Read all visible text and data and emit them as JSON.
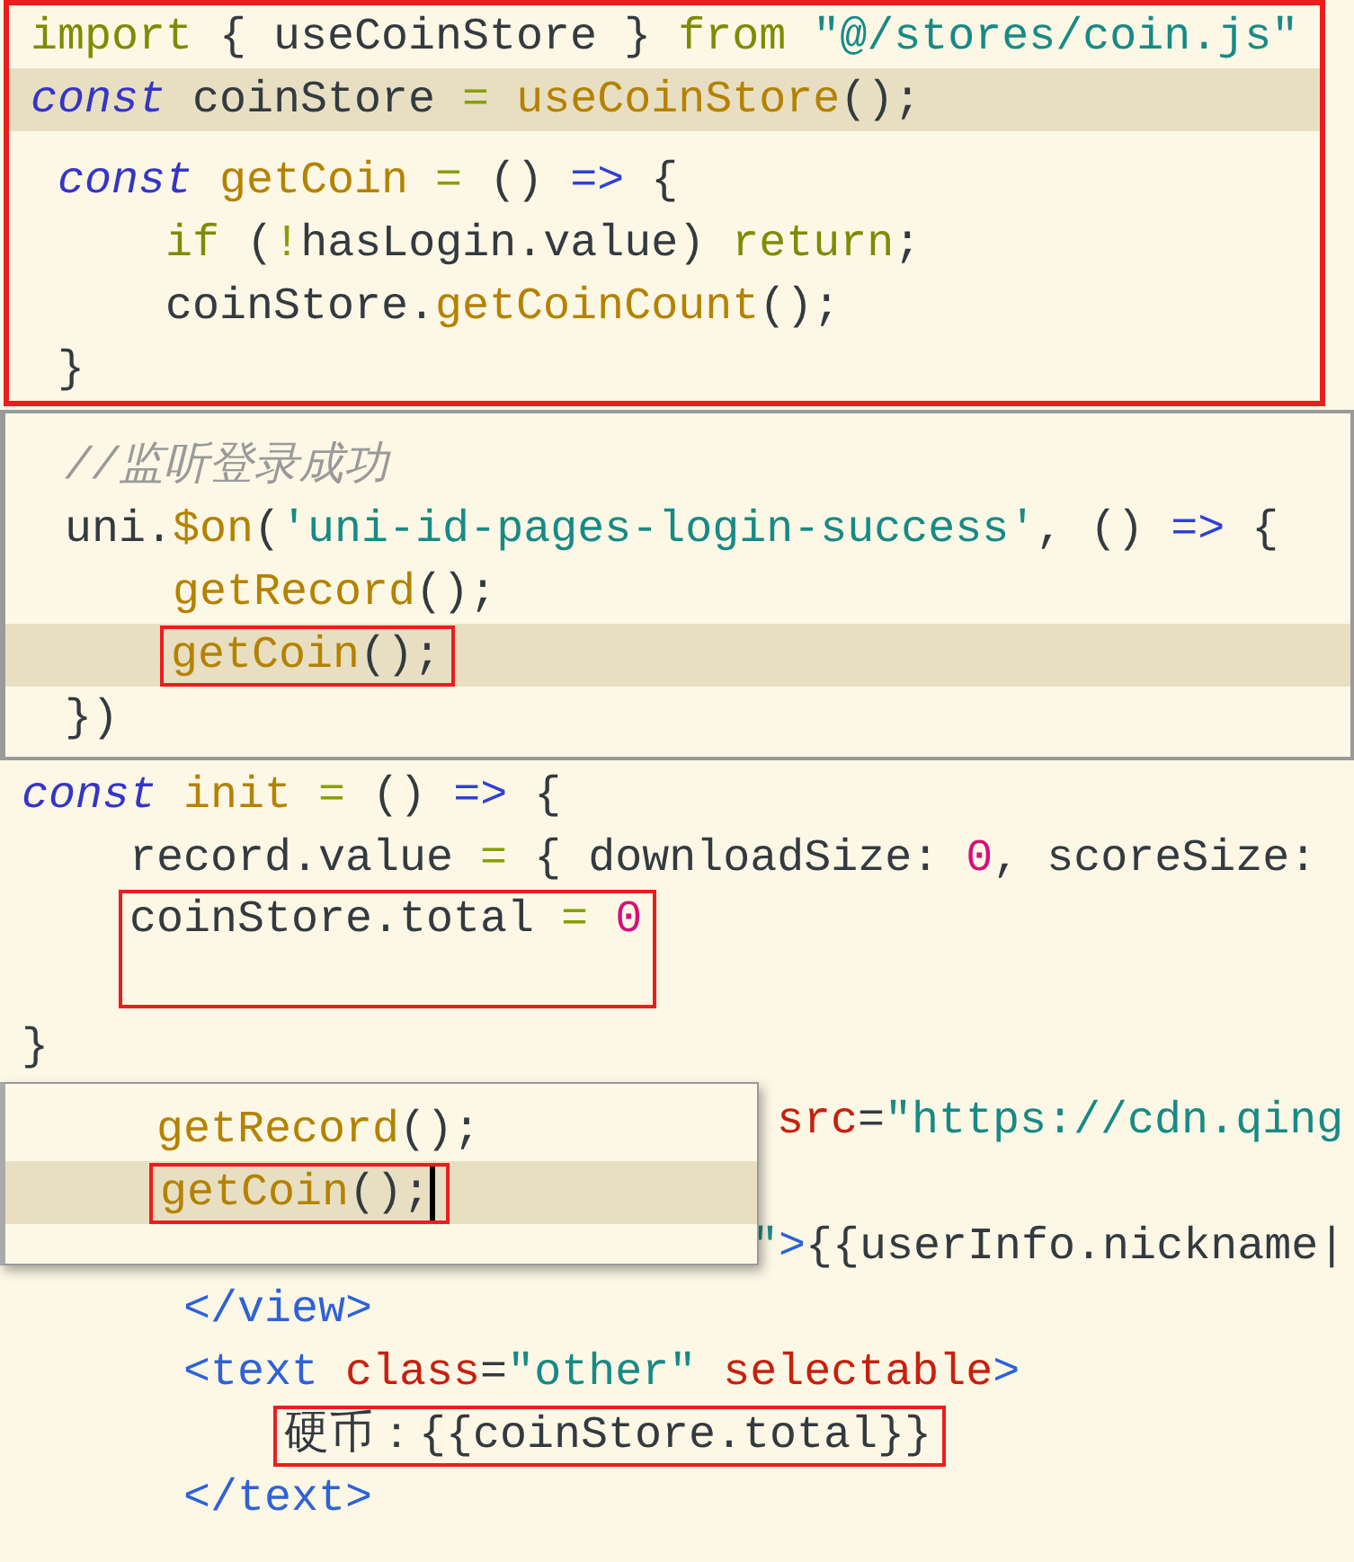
{
  "panels": [
    {
      "kind": "editor",
      "boxed": true,
      "lines": [
        {
          "kind": "code",
          "tokens": [
            {
              "kind": "ctl",
              "t": "import"
            },
            {
              "kind": "plain",
              "t": " { useCoinStore } "
            },
            {
              "kind": "ctl",
              "t": "from"
            },
            {
              "kind": "str",
              "t": " \"@/stores/coin.js\""
            }
          ]
        },
        {
          "kind": "code",
          "highlighted": true,
          "tokens": [
            {
              "kind": "kw",
              "t": "const"
            },
            {
              "kind": "plain",
              "t": " coinStore "
            },
            {
              "kind": "op",
              "t": "= "
            },
            {
              "kind": "fn",
              "t": "useCoinStore"
            },
            {
              "kind": "plain",
              "t": "();"
            }
          ]
        },
        {
          "kind": "code",
          "tokens": [
            {
              "kind": "kw",
              "t": " const"
            },
            {
              "kind": "fn",
              "t": " getCoin"
            },
            {
              "kind": "op",
              "t": " ="
            },
            {
              "kind": "plain",
              "t": " () "
            },
            {
              "kind": "arrow",
              "t": "=>"
            },
            {
              "kind": "plain",
              "t": " {"
            }
          ]
        },
        {
          "kind": "code",
          "tokens": [
            {
              "kind": "ctl",
              "t": "     if"
            },
            {
              "kind": "plain",
              "t": " ("
            },
            {
              "kind": "op",
              "t": "!"
            },
            {
              "kind": "plain",
              "t": "hasLogin.value) "
            },
            {
              "kind": "ctl",
              "t": "return"
            },
            {
              "kind": "plain",
              "t": ";"
            }
          ]
        },
        {
          "kind": "code",
          "tokens": [
            {
              "kind": "plain",
              "t": "     coinStore."
            },
            {
              "kind": "fn",
              "t": "getCoinCount"
            },
            {
              "kind": "plain",
              "t": "();"
            }
          ]
        },
        {
          "kind": "code",
          "tokens": [
            {
              "kind": "plain",
              "t": " }"
            }
          ]
        }
      ]
    },
    {
      "kind": "editor",
      "framed": true,
      "lines": [
        {
          "kind": "code",
          "tokens": [
            {
              "kind": "comment",
              "t": " //监听登录成功"
            }
          ]
        },
        {
          "kind": "code",
          "tokens": [
            {
              "kind": "plain",
              "t": " uni."
            },
            {
              "kind": "fn",
              "t": "$on"
            },
            {
              "kind": "plain",
              "t": "("
            },
            {
              "kind": "str",
              "t": "'uni-id-pages-login-success'"
            },
            {
              "kind": "plain",
              "t": ", () "
            },
            {
              "kind": "arrow",
              "t": "=>"
            },
            {
              "kind": "plain",
              "t": " {"
            }
          ]
        },
        {
          "kind": "code",
          "tokens": [
            {
              "kind": "fn",
              "t": "     getRecord"
            },
            {
              "kind": "plain",
              "t": "();"
            }
          ]
        },
        {
          "kind": "code",
          "highlighted": true,
          "boxed": true,
          "tokens": [
            {
              "kind": "fn",
              "t": "getCoin"
            },
            {
              "kind": "plain",
              "t": "();"
            }
          ]
        },
        {
          "kind": "code",
          "tokens": [
            {
              "kind": "plain",
              "t": " })"
            }
          ]
        }
      ]
    },
    {
      "kind": "editor",
      "lines": [
        {
          "kind": "code",
          "tokens": [
            {
              "kind": "kw",
              "t": "const"
            },
            {
              "kind": "fn",
              "t": " init"
            },
            {
              "kind": "op",
              "t": " ="
            },
            {
              "kind": "plain",
              "t": " () "
            },
            {
              "kind": "arrow",
              "t": "=>"
            },
            {
              "kind": "plain",
              "t": " {"
            }
          ]
        },
        {
          "kind": "code",
          "tokens": [
            {
              "kind": "plain",
              "t": "    record.value "
            },
            {
              "kind": "op",
              "t": "="
            },
            {
              "kind": "plain",
              "t": " { downloadSize: "
            },
            {
              "kind": "num",
              "t": "0"
            },
            {
              "kind": "plain",
              "t": ", scoreSize:"
            }
          ]
        },
        {
          "kind": "code",
          "boxed": true,
          "tokens": [
            {
              "kind": "plain",
              "t": "coinStore.total "
            },
            {
              "kind": "op",
              "t": "="
            },
            {
              "kind": "num",
              "t": " 0"
            }
          ]
        },
        {
          "kind": "blank"
        },
        {
          "kind": "code",
          "tokens": [
            {
              "kind": "plain",
              "t": "}"
            }
          ]
        }
      ]
    },
    {
      "kind": "overlay",
      "lines": [
        {
          "kind": "code",
          "hidden_start": true,
          "tokens": [
            {
              "kind": "attr",
              "t": "src"
            },
            {
              "kind": "plain",
              "t": "="
            },
            {
              "kind": "str",
              "t": "\"https://cdn.qing"
            }
          ]
        },
        {
          "kind": "blank"
        },
        {
          "kind": "code",
          "hidden_start": true,
          "tokens": [
            {
              "kind": "str",
              "t": "\""
            },
            {
              "kind": "tag",
              "t": ">"
            },
            {
              "kind": "plain",
              "t": "{{userInfo.nickname|"
            }
          ]
        },
        {
          "kind": "code",
          "tokens": [
            {
              "kind": "tag",
              "t": "      </view>"
            }
          ]
        },
        {
          "kind": "code",
          "tokens": [
            {
              "kind": "tag",
              "t": "      <text"
            },
            {
              "kind": "attr",
              "t": " class"
            },
            {
              "kind": "plain",
              "t": "="
            },
            {
              "kind": "str",
              "t": "\"other\""
            },
            {
              "kind": "attr",
              "t": " selectable"
            },
            {
              "kind": "tag",
              "t": ">"
            }
          ]
        },
        {
          "kind": "code",
          "boxed": true,
          "tokens": [
            {
              "kind": "plain",
              "t": "硬币：{{coinStore.total}}"
            }
          ]
        },
        {
          "kind": "code",
          "tokens": [
            {
              "kind": "tag",
              "t": "      </text>"
            }
          ]
        }
      ],
      "popup": {
        "lines": [
          {
            "kind": "code",
            "tokens": [
              {
                "kind": "fn",
                "t": "    getRecord"
              },
              {
                "kind": "plain",
                "t": "();"
              }
            ]
          },
          {
            "kind": "code",
            "highlighted": true,
            "boxed": true,
            "caret": true,
            "tokens": [
              {
                "kind": "fn",
                "t": "getCoin"
              },
              {
                "kind": "plain",
                "t": "();"
              }
            ]
          }
        ]
      }
    }
  ]
}
